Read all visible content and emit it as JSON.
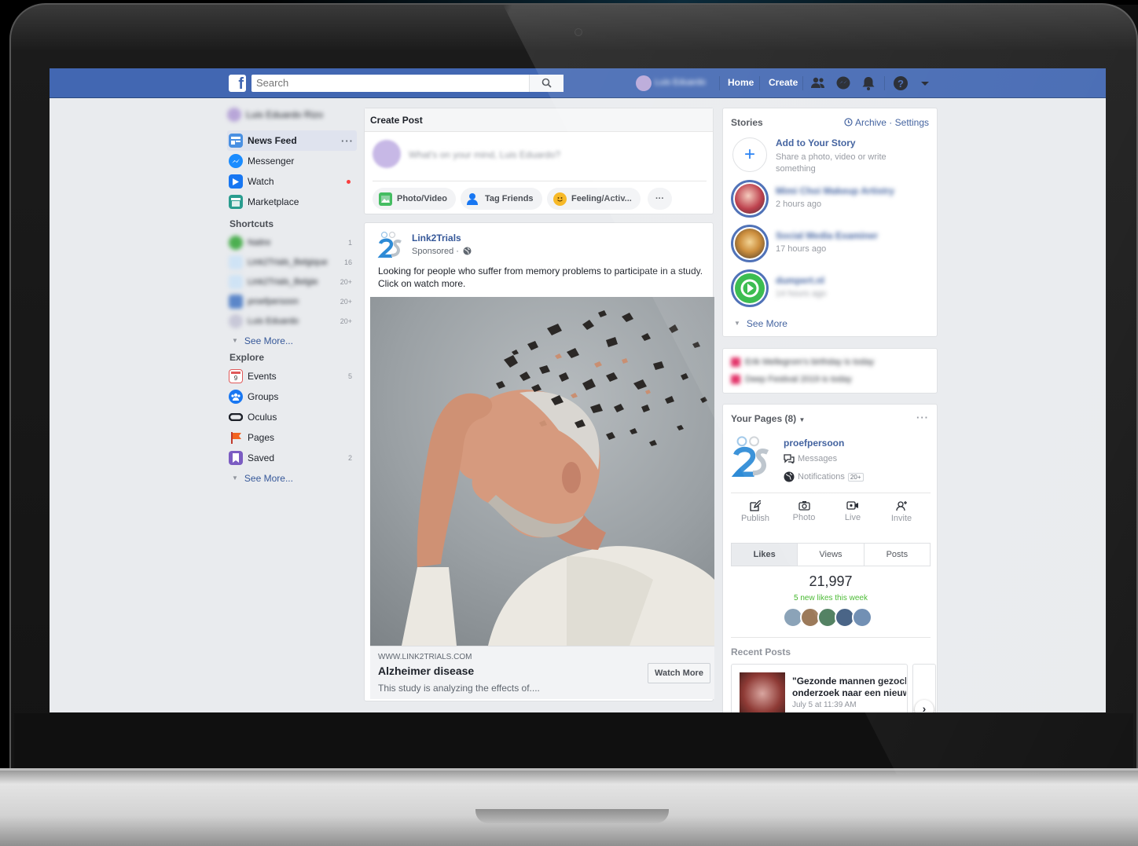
{
  "topbar": {
    "search_placeholder": "Search",
    "user_name": "Luis Eduardo",
    "home": "Home",
    "create": "Create",
    "brand_color": "#4267b2"
  },
  "left_nav": {
    "profile_name": "Luis Eduardo Rizo",
    "main": [
      {
        "label": "News Feed",
        "icon": "news-feed-icon",
        "count": ""
      },
      {
        "label": "Messenger",
        "icon": "messenger-icon",
        "count": ""
      },
      {
        "label": "Watch",
        "icon": "watch-icon",
        "count": ""
      },
      {
        "label": "Marketplace",
        "icon": "marketplace-icon",
        "count": ""
      }
    ],
    "shortcuts_heading": "Shortcuts",
    "shortcuts": [
      {
        "label": "Naitre",
        "count": "1"
      },
      {
        "label": "Link2Trials_Belgique",
        "count": "16"
      },
      {
        "label": "Link2Trials_Belgie",
        "count": "20+"
      },
      {
        "label": "proefpersoon",
        "count": "20+"
      },
      {
        "label": "Luis Eduardo",
        "count": "20+"
      }
    ],
    "see_more": "See More...",
    "explore_heading": "Explore",
    "explore": [
      {
        "label": "Events",
        "icon": "events-icon",
        "count": "5"
      },
      {
        "label": "Groups",
        "icon": "groups-icon",
        "count": ""
      },
      {
        "label": "Oculus",
        "icon": "oculus-icon",
        "count": ""
      },
      {
        "label": "Pages",
        "icon": "pages-icon",
        "count": ""
      },
      {
        "label": "Saved",
        "icon": "saved-icon",
        "count": "2"
      }
    ]
  },
  "create_post": {
    "heading": "Create Post",
    "placeholder": "What's on your mind, Luis Eduardo?",
    "photo_video": "Photo/Video",
    "tag_friends": "Tag Friends",
    "feeling": "Feeling/Activ...",
    "more": "···"
  },
  "post": {
    "author": "Link2Trials",
    "sponsored": "Sponsored ·",
    "text": "Looking for people who suffer from memory problems to participate in a study. Click on watch more.",
    "link_domain": "WWW.LINK2TRIALS.COM",
    "link_title": "Alzheimer disease",
    "link_desc": "This study is analyzing the effects of....",
    "cta": "Watch More"
  },
  "stories": {
    "heading": "Stories",
    "archive": "Archive",
    "settings": "Settings",
    "add_title": "Add to Your Story",
    "add_sub": "Share a photo, video or write something",
    "items": [
      {
        "name": "Mimi Choi Makeup Artistry",
        "time": "2 hours ago"
      },
      {
        "name": "Social Media Examiner",
        "time": "17 hours ago"
      },
      {
        "name": "dumpert.nl",
        "time": "14 hours ago"
      }
    ],
    "see_more": "See More"
  },
  "birthdays": {
    "line1": "Erik Mellegrom's birthday is today",
    "line2": "Deep Festival 2019 is today"
  },
  "your_pages": {
    "heading": "Your Pages (8)",
    "page_name": "proefpersoon",
    "messages": "Messages",
    "notifications": "Notifications",
    "notif_badge": "20+",
    "actions": [
      "Publish",
      "Photo",
      "Live",
      "Invite"
    ],
    "tabs": [
      "Likes",
      "Views",
      "Posts"
    ],
    "likes": "21,997",
    "new_likes": "5 new likes this week",
    "recent_heading": "Recent Posts",
    "recent_title": "\"Gezonde mannen gezocht\" onderzoek naar een nieuw",
    "recent_title_l1": "\"Gezonde mannen gezocht",
    "recent_title_l2": "onderzoek naar een nieuw",
    "recent_time": "July 5 at 11:39 AM"
  }
}
